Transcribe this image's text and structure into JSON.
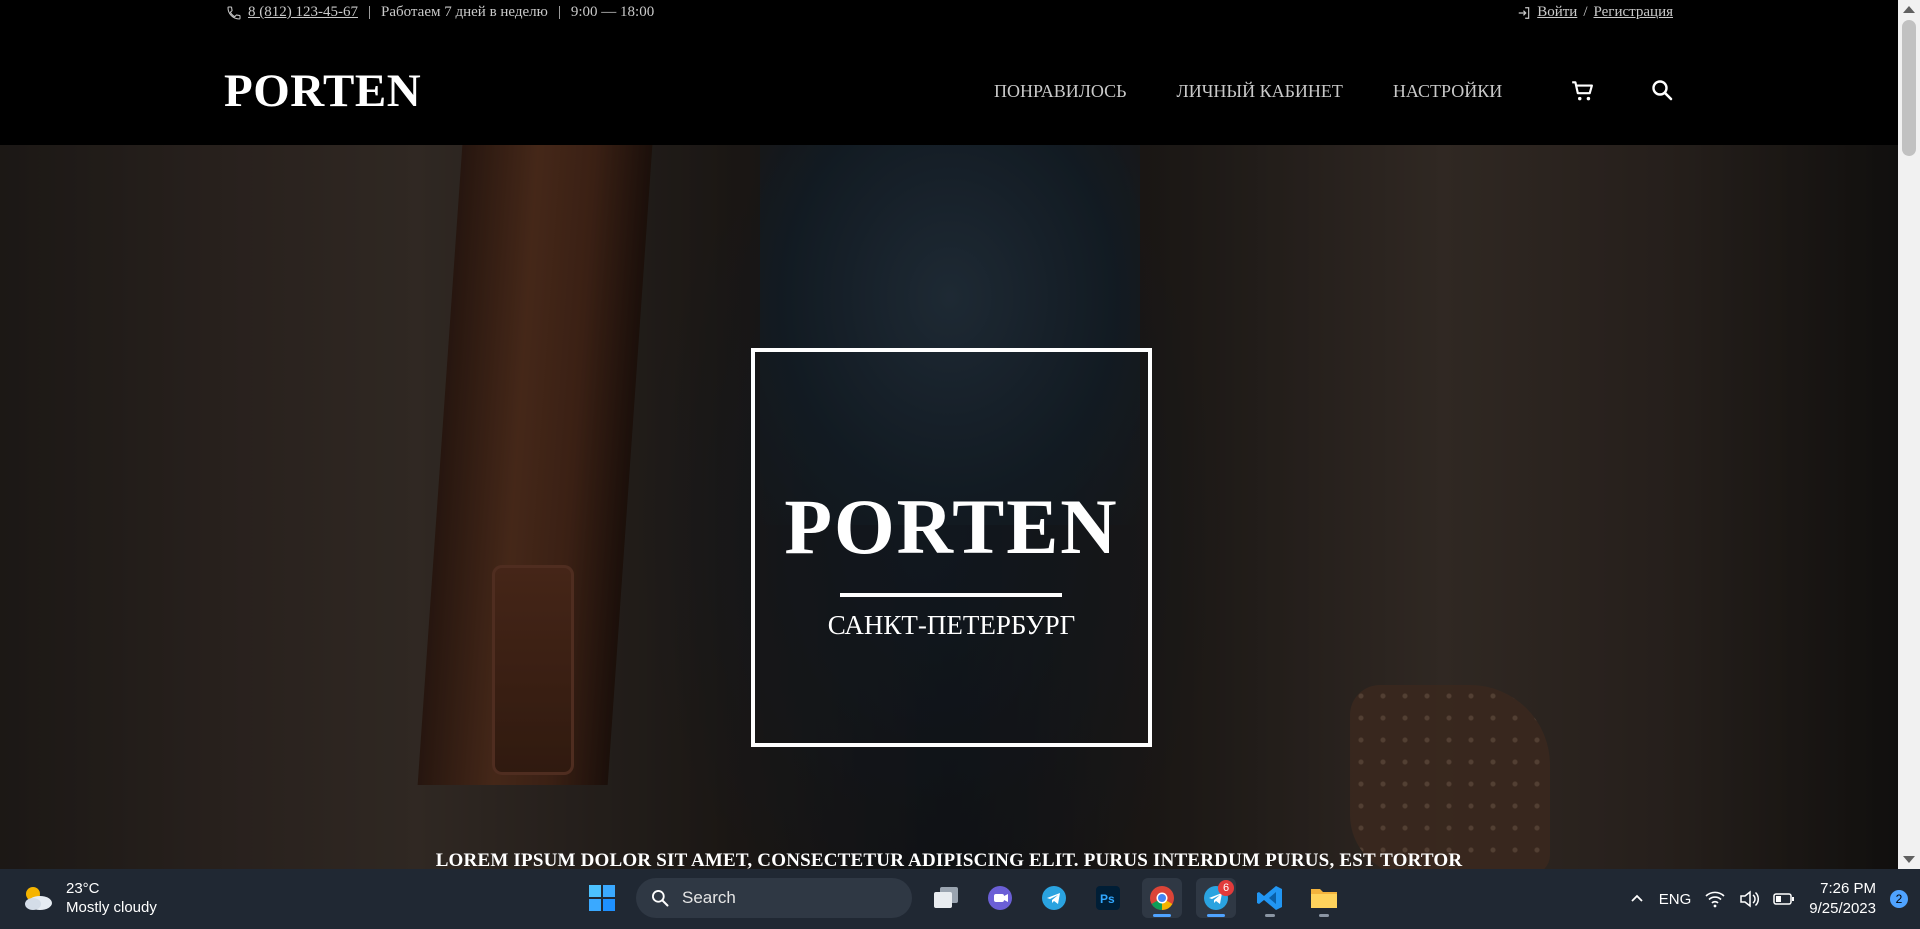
{
  "topline": {
    "phone": "8 (812) 123-45-67",
    "hours": "Работаем 7 дней в неделю",
    "time": "9:00 — 18:00",
    "login": "Войти",
    "slash": "/",
    "register": "Регистрация"
  },
  "header": {
    "brand": "PORTEN",
    "nav": [
      "ПОНРАВИЛОСЬ",
      "ЛИЧНЫЙ КАБИНЕТ",
      "НАСТРОЙКИ"
    ]
  },
  "hero": {
    "title": "PORTEN",
    "city": "САНКТ-ПЕТЕРБУРГ",
    "tagline": "LOREM IPSUM DOLOR SIT AMET, CONSECTETUR ADIPISCING ELIT. PURUS INTERDUM PURUS, EST TORTOR"
  },
  "taskbar": {
    "weather_temp": "23°C",
    "weather_desc": "Mostly cloudy",
    "search_label": "Search",
    "telegram_badge": "6",
    "lang": "ENG",
    "time": "7:26 PM",
    "date": "9/25/2023",
    "notifications": "2"
  },
  "colors": {
    "header_bg": "#000000",
    "topline_text": "#c9c9c9",
    "taskbar_bg": "#202833",
    "accent": "#4fa3ff"
  }
}
